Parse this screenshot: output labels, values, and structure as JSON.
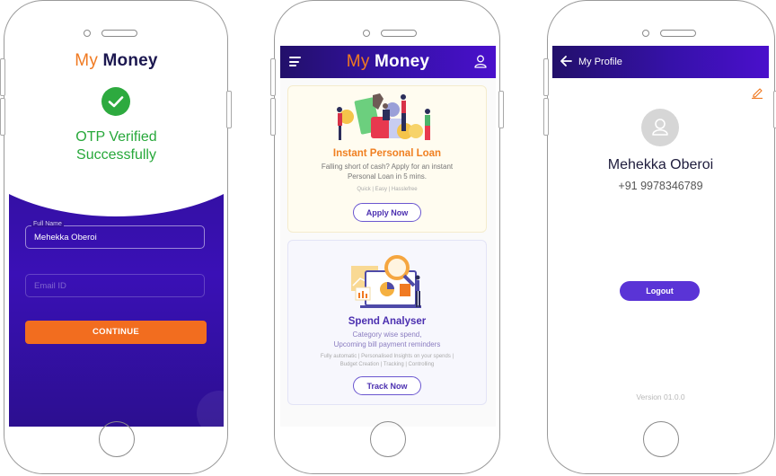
{
  "screens": {
    "otp": {
      "logo": {
        "my": "My",
        "money": "Money"
      },
      "status_icon": "check-circle-icon",
      "status_line1": "OTP Verified",
      "status_line2": "Successfully",
      "full_name": {
        "label": "Full Name",
        "value": "Mehekka Oberoi"
      },
      "email": {
        "placeholder": "Email ID",
        "value": ""
      },
      "continue_label": "CONTINUE"
    },
    "home": {
      "menu_icon": "hamburger-menu-icon",
      "logo": {
        "my": "My",
        "money": "Money"
      },
      "profile_icon": "user-icon",
      "cards": [
        {
          "title": "Instant Personal Loan",
          "description_line1": "Falling short of cash? Apply for an instant",
          "description_line2": "Personal Loan in 5 mins.",
          "tags": "Quick  |  Easy  |  Hasslefree",
          "button_label": "Apply Now",
          "illustration": "people-with-money-illustration"
        },
        {
          "title": "Spend Analyser",
          "description_line1": "Category wise spend,",
          "description_line2": "Upcoming bill payment reminders",
          "tags_line1": "Fully automatic | Personalised Insights on your spends |",
          "tags_line2": "Budget Creation | Tracking | Controlling",
          "button_label": "Track Now",
          "illustration": "analytics-magnifier-illustration"
        }
      ]
    },
    "profile": {
      "back_icon": "arrow-left-icon",
      "title": "My Profile",
      "edit_icon": "pencil-icon",
      "avatar_icon": "user-avatar-icon",
      "name": "Mehekka Oberoi",
      "phone": "+91 9978346789",
      "logout_label": "Logout",
      "version": "Version 01.0.0"
    }
  },
  "colors": {
    "brand_orange": "#f07a22",
    "brand_navy": "#1c1850",
    "brand_purple": "#3a10b6",
    "success_green": "#2daa3f",
    "button_purple": "#5a34d6"
  }
}
